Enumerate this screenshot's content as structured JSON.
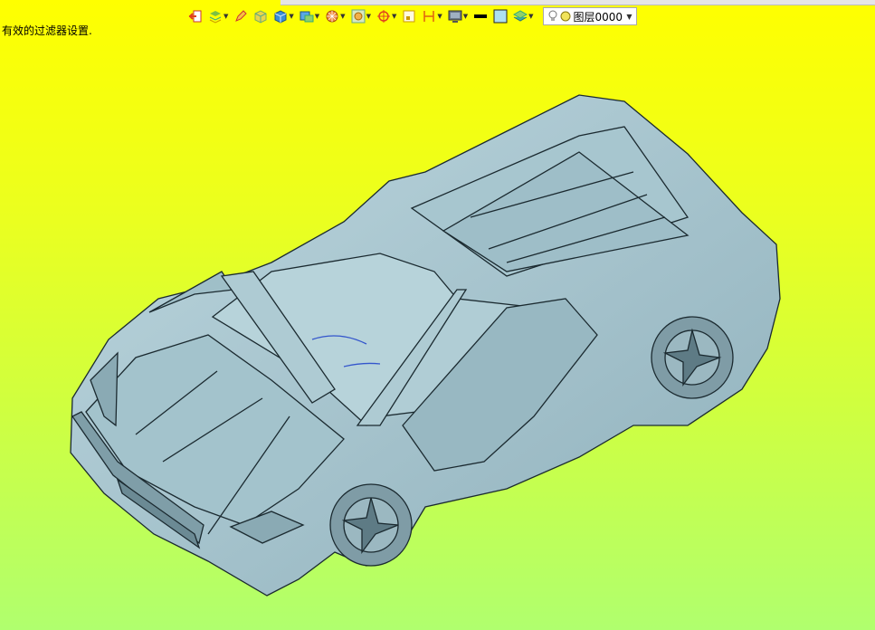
{
  "status": {
    "message": "有效的过滤器设置."
  },
  "toolbar": {
    "layer": {
      "value": "图层0000"
    },
    "buttons": [
      {
        "name": "exit-icon",
        "dropdown": false
      },
      {
        "name": "layer-manager-icon",
        "dropdown": true
      },
      {
        "name": "pencil-icon",
        "dropdown": false
      },
      {
        "name": "solid-box-icon",
        "dropdown": false
      },
      {
        "name": "shaded-cube-icon",
        "dropdown": true
      },
      {
        "name": "display-mode-icon",
        "dropdown": true
      },
      {
        "name": "render-sphere-icon",
        "dropdown": true
      },
      {
        "name": "view-orient-icon",
        "dropdown": true
      },
      {
        "name": "crosshair-icon",
        "dropdown": true
      },
      {
        "name": "frame-icon",
        "dropdown": false
      },
      {
        "name": "dimension-icon",
        "dropdown": true
      },
      {
        "name": "monitor-icon",
        "dropdown": true
      },
      {
        "name": "line-color-icon",
        "dropdown": false
      },
      {
        "name": "fill-color-icon",
        "dropdown": false
      },
      {
        "name": "layers-stack-icon",
        "dropdown": true
      }
    ],
    "colors": {
      "line": "#000000",
      "fill": "#aee0ef"
    }
  },
  "viewport": {
    "background_top": "#ffff00",
    "background_bottom": "#b0ff6e",
    "model_color": "#a9c8d2",
    "model_name": "sports-car-model"
  }
}
